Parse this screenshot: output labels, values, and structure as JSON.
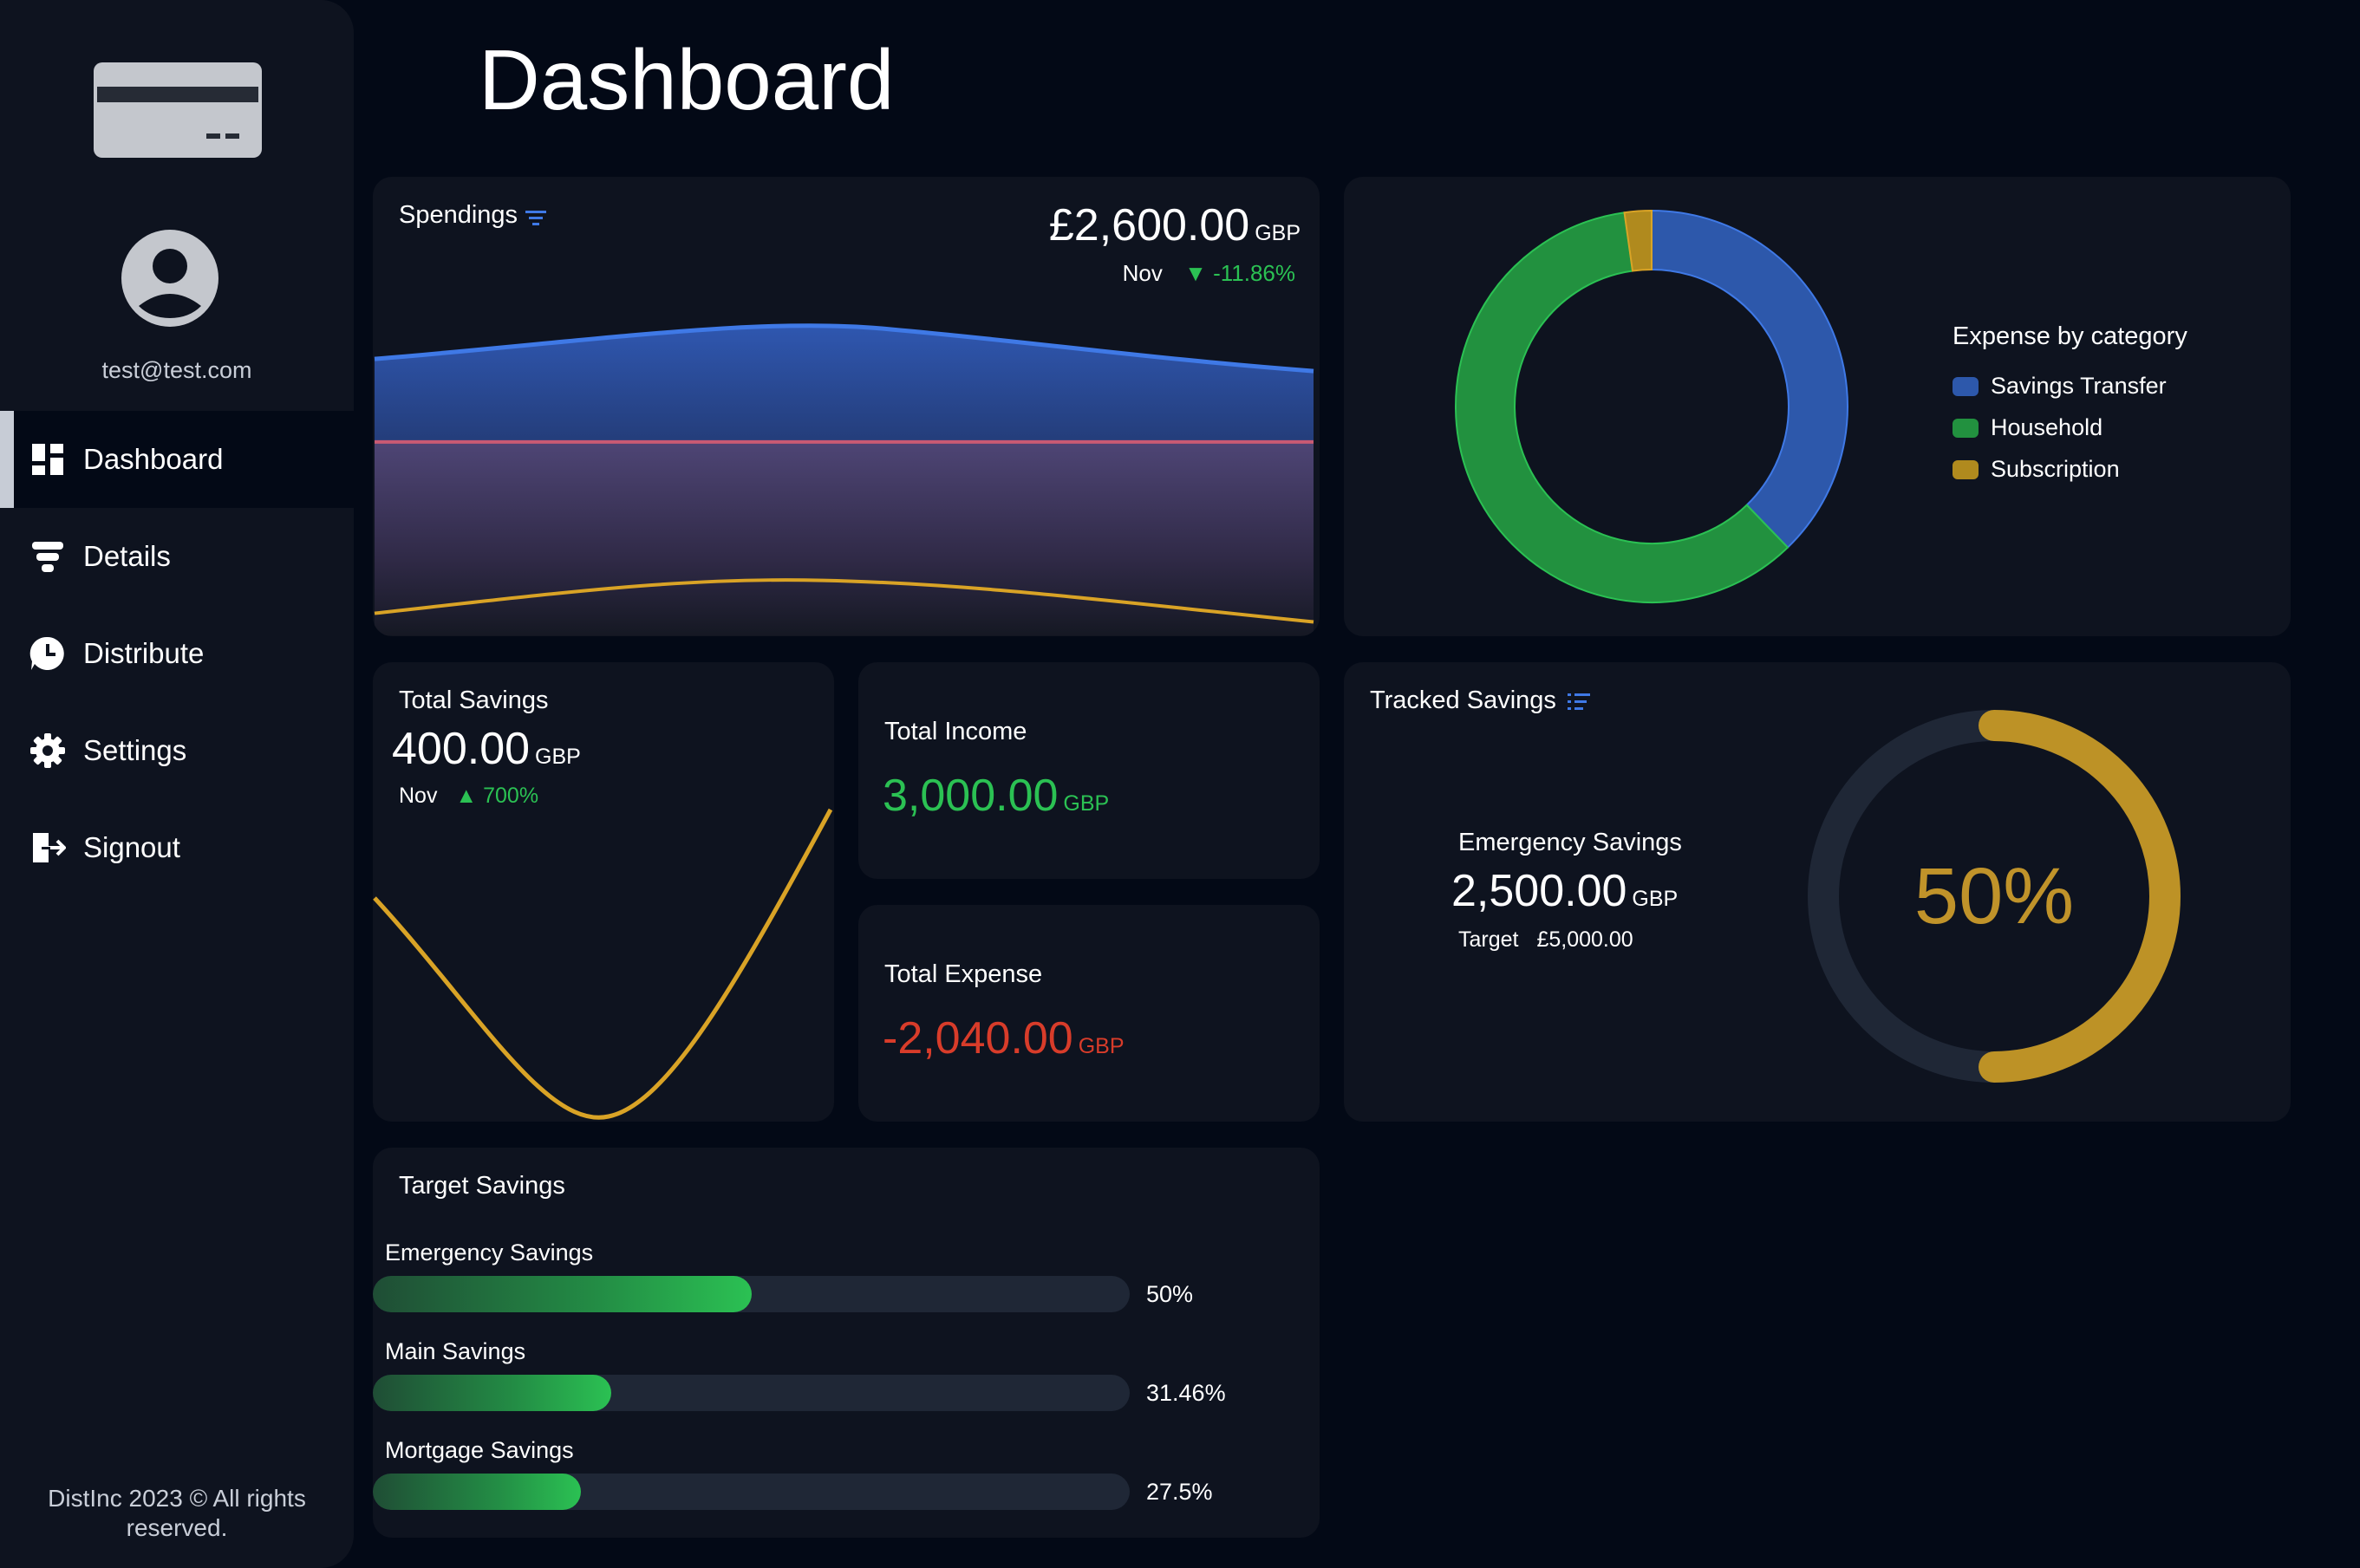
{
  "app": {
    "page_title": "Dashboard"
  },
  "sidebar": {
    "email": "test@test.com",
    "footer": "DistInc 2023 © All rights reserved.",
    "items": [
      {
        "label": "Dashboard",
        "icon": "dashboard-icon",
        "active": true
      },
      {
        "label": "Details",
        "icon": "details-icon",
        "active": false
      },
      {
        "label": "Distribute",
        "icon": "distribute-icon",
        "active": false
      },
      {
        "label": "Settings",
        "icon": "gear-icon",
        "active": false
      },
      {
        "label": "Signout",
        "icon": "signout-icon",
        "active": false
      }
    ]
  },
  "spendings": {
    "title": "Spendings",
    "amount": "£2,600.00",
    "currency": "GBP",
    "month": "Nov",
    "change": "-11.86%",
    "change_direction": "down"
  },
  "expense_by_category": {
    "title": "Expense by category",
    "legend": [
      {
        "label": "Savings Transfer",
        "color": "#2d58ab"
      },
      {
        "label": "Household",
        "color": "#22913f"
      },
      {
        "label": "Subscription",
        "color": "#b08a1e"
      }
    ]
  },
  "total_savings": {
    "title": "Total Savings",
    "amount": "400.00",
    "currency": "GBP",
    "month": "Nov",
    "change": "700%",
    "change_direction": "up"
  },
  "total_income": {
    "title": "Total Income",
    "amount": "3,000.00",
    "currency": "GBP"
  },
  "total_expense": {
    "title": "Total Expense",
    "amount": "-2,040.00",
    "currency": "GBP"
  },
  "tracked_savings": {
    "title": "Tracked Savings",
    "name": "Emergency Savings",
    "amount": "2,500.00",
    "currency": "GBP",
    "target_label": "Target",
    "target_value": "£5,000.00",
    "percent_text": "50%",
    "percent": 0.5
  },
  "target_savings": {
    "title": "Target Savings",
    "items": [
      {
        "label": "Emergency Savings",
        "pct_text": "50%",
        "pct": 0.5
      },
      {
        "label": "Main Savings",
        "pct_text": "31.46%",
        "pct": 0.3146
      },
      {
        "label": "Mortgage Savings",
        "pct_text": "27.5%",
        "pct": 0.275
      }
    ]
  },
  "colors": {
    "background": "#030916",
    "panel": "#0e131f",
    "positive": "#2bc153",
    "negative": "#d83c2a",
    "accent_gold": "#c0932a",
    "accent_blue": "#3f79e6"
  }
}
